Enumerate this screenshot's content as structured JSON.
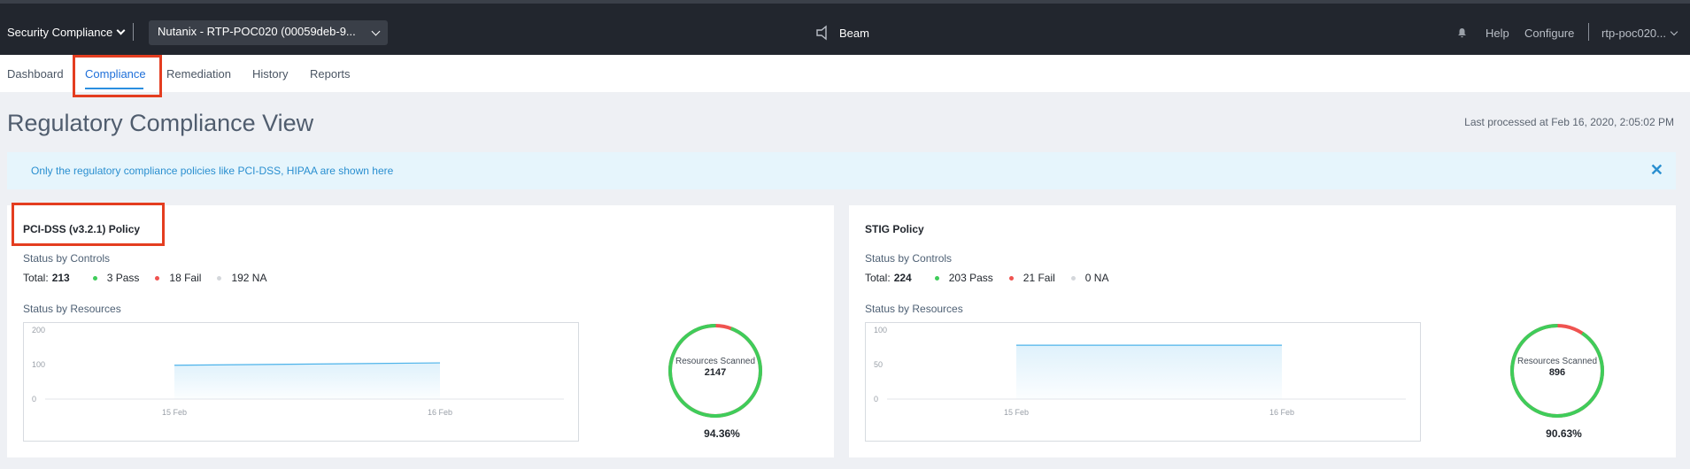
{
  "topbar": {
    "app_switcher": "Security Compliance",
    "account": "Nutanix - RTP-POC020 (00059deb-9...",
    "brand": "Beam",
    "help": "Help",
    "configure": "Configure",
    "user": "rtp-poc020..."
  },
  "tabs": [
    {
      "label": "Dashboard"
    },
    {
      "label": "Compliance",
      "active": true
    },
    {
      "label": "Remediation"
    },
    {
      "label": "History"
    },
    {
      "label": "Reports"
    }
  ],
  "page": {
    "title": "Regulatory Compliance View",
    "last_processed": "Last processed at Feb 16, 2020, 2:05:02 PM"
  },
  "banner": {
    "text": "Only the regulatory compliance policies like PCI-DSS, HIPAA are shown here",
    "close": "✕"
  },
  "colors": {
    "pass": "#3fcc5a",
    "fail": "#ef5350",
    "na": "#d4d7db",
    "line": "#4db3ea",
    "highlight": "#e43d20"
  },
  "policies": [
    {
      "title": "PCI-DSS (v3.2.1) Policy",
      "status_by_controls": "Status by Controls",
      "total_label": "Total:",
      "total": "213",
      "pass": "3 Pass",
      "fail": "18 Fail",
      "na": "192 NA",
      "status_by_resources": "Status by Resources",
      "resources_scanned_label": "Resources Scanned",
      "resources_scanned": "2147",
      "percent": "94.36%",
      "percent_value": 94.36,
      "chart_data": {
        "type": "area",
        "x": [
          "15 Feb",
          "16 Feb"
        ],
        "series": [
          {
            "values": [
              98,
              105
            ]
          }
        ],
        "ylim": [
          0,
          200
        ],
        "yticks": [
          "200",
          "100",
          "0"
        ]
      }
    },
    {
      "title": "STIG Policy",
      "status_by_controls": "Status by Controls",
      "total_label": "Total:",
      "total": "224",
      "pass": "203 Pass",
      "fail": "21 Fail",
      "na": "0 NA",
      "status_by_resources": "Status by Resources",
      "resources_scanned_label": "Resources Scanned",
      "resources_scanned": "896",
      "percent": "90.63%",
      "percent_value": 90.63,
      "chart_data": {
        "type": "area",
        "x": [
          "15 Feb",
          "16 Feb"
        ],
        "series": [
          {
            "values": [
              78,
              78
            ]
          }
        ],
        "ylim": [
          0,
          100
        ],
        "yticks": [
          "100",
          "50",
          "0"
        ]
      }
    }
  ]
}
